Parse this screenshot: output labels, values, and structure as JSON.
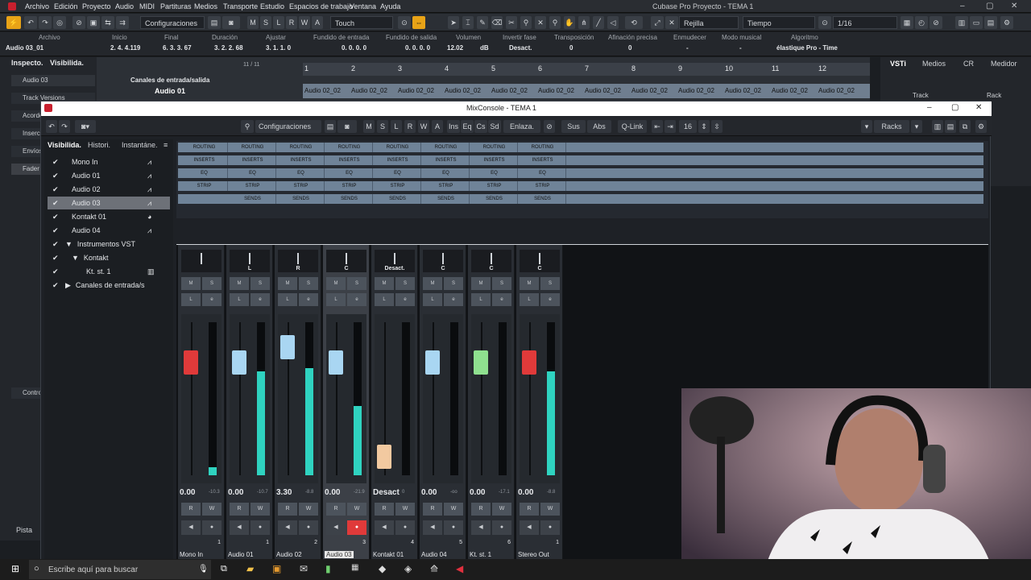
{
  "menubar": {
    "items": [
      "Archivo",
      "Edición",
      "Proyecto",
      "Audio",
      "MIDI",
      "Partituras",
      "Medios",
      "Transporte",
      "Estudio",
      "Espacios de trabajo",
      "Ventana",
      "Ayuda"
    ],
    "title": "Cubase Pro Proyecto - TEMA 1"
  },
  "toolbar": {
    "config": "Configuraciones",
    "mode": "Touch",
    "snap": "Rejilla",
    "timebase": "Tiempo",
    "quant": "1/16",
    "mute": "M",
    "solo": "S",
    "listen": "L",
    "read": "R",
    "write": "W",
    "automation": "A"
  },
  "infoline": {
    "headers": [
      "Archivo",
      "Inicio",
      "Final",
      "Duración",
      "Ajustar",
      "Fundido de entrada",
      "Fundido de salida",
      "Volumen",
      "Invertir fase",
      "Transposición",
      "Afinación precisa",
      "Enmudecer",
      "Modo musical",
      "Algoritmo"
    ],
    "values": [
      "Audio 03_01",
      "2. 4. 4.119",
      "6. 3. 3. 67",
      "3. 2. 2. 68",
      "3. 1. 1.  0",
      "0. 0. 0.  0",
      "0. 0. 0.  0",
      "12.02",
      "dB",
      "Desact.",
      "0",
      "0",
      "-",
      "-",
      "élastique Pro - Time"
    ]
  },
  "leftpanel": {
    "tabs": [
      "Inspecto.",
      "Visibilida."
    ],
    "items": [
      "Audio 03",
      "Track Versions",
      "Acorde",
      "Inserciones",
      "Envíos",
      "Fader",
      "Controles rápidos",
      "Pista"
    ]
  },
  "arrange": {
    "counter": "11 / 11",
    "folder": "Canales de entrada/salida",
    "track": "Audio 01",
    "ruler": [
      "1",
      "2",
      "3",
      "4",
      "5",
      "6",
      "7",
      "8",
      "9",
      "10",
      "11",
      "12"
    ],
    "clip": "Audio 02_02"
  },
  "rightpanel": {
    "tabs": [
      "VSTi",
      "Medios",
      "CR",
      "Medidor"
    ],
    "sub": [
      "Track",
      "Rack"
    ]
  },
  "mixconsole": {
    "title": "MixConsole - TEMA 1",
    "config": "Configuraciones",
    "buttons": [
      "M",
      "S",
      "L",
      "R",
      "W",
      "A"
    ],
    "ins": "Ins",
    "eq": "Eq",
    "cs": "Cs",
    "sd": "Sd",
    "link": "Enlaza.",
    "sus": "Sus",
    "abs": "Abs",
    "qlink": "Q-Link",
    "qlinkcount": "16",
    "racks": "Racks"
  },
  "visibility": {
    "tabs": [
      "Visibilida.",
      "Histori.",
      "Instantáne."
    ],
    "items": [
      "Mono In",
      "Audio 01",
      "Audio 02",
      "Audio 03",
      "Kontakt 01",
      "Audio 04",
      "Instrumentos VST",
      "Kontakt",
      "Kt. st. 1",
      "Canales de entrada/s"
    ]
  },
  "racklabels": {
    "routing": "ROUTING",
    "inserts": "INSERTS",
    "eq": "EQ",
    "strip": "STRIP",
    "sends": "SENDS"
  },
  "channels": [
    {
      "name": "Mono In",
      "num": "1",
      "pan": "",
      "vol": "0.00",
      "peak": "-10.3",
      "color": "#e03a3a",
      "level": 0.05,
      "knob": 0.78
    },
    {
      "name": "Audio 01",
      "num": "1",
      "pan": "L",
      "vol": "0.00",
      "peak": "-10.7",
      "color": "#a9d6f2",
      "level": 0.68,
      "knob": 0.78
    },
    {
      "name": "Audio 02",
      "num": "2",
      "pan": "R",
      "vol": "3.30",
      "peak": "-8.8",
      "color": "#a9d6f2",
      "level": 0.7,
      "knob": 0.9
    },
    {
      "name": "Audio 03",
      "num": "3",
      "pan": "C",
      "vol": "0.00",
      "peak": "-21.9",
      "color": "#a9d6f2",
      "level": 0.45,
      "knob": 0.78
    },
    {
      "name": "Kontakt 01",
      "num": "4",
      "pan": "Desact.",
      "vol": "Desact",
      "peak": "0",
      "color": "#f2c9a0",
      "level": 0.0,
      "knob": 0.05
    },
    {
      "name": "Audio 04",
      "num": "5",
      "pan": "C",
      "vol": "0.00",
      "peak": "-oo",
      "color": "#a9d6f2",
      "level": 0.0,
      "knob": 0.78
    },
    {
      "name": "Kt. st. 1",
      "num": "6",
      "pan": "C",
      "vol": "0.00",
      "peak": "-17.1",
      "color": "#8fe08f",
      "level": 0.0,
      "knob": 0.78
    },
    {
      "name": "Stereo Out",
      "num": "1",
      "pan": "C",
      "vol": "0.00",
      "peak": "-8.8",
      "color": "#e03a3a",
      "level": 0.68,
      "knob": 0.78
    }
  ],
  "strip_buttons": {
    "mute": "M",
    "solo": "S",
    "listen": "L",
    "read": "R",
    "write": "W"
  },
  "taskbar": {
    "search": "Escribe aquí para buscar"
  }
}
